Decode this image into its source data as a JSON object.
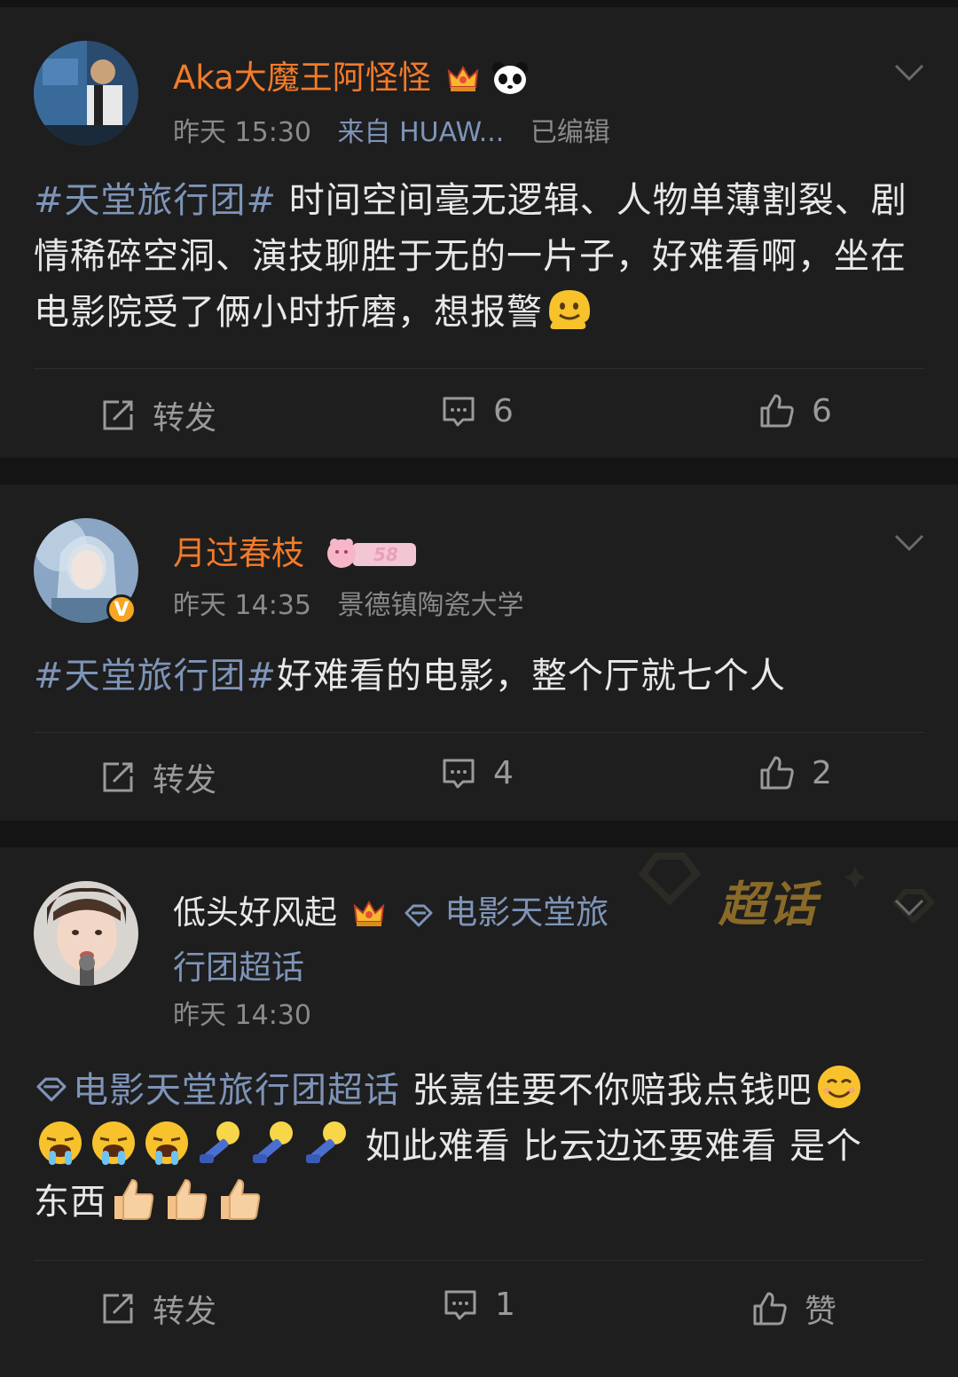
{
  "posts": [
    {
      "username": "Aka大魔王阿怪怪",
      "time": "昨天 15:30",
      "source": "来自 HUAW...",
      "edited": "已编辑",
      "topic": "#天堂旅行团#",
      "text": " 时间空间毫无逻辑、人物单薄割裂、剧情稀碎空洞、演技聊胜于无的一片子，好难看啊，坐在电影院受了俩小时折磨，想报警",
      "emojis": [
        "melting-face-emoji"
      ],
      "repost_label": "转发",
      "comment_count": "6",
      "like_count": "6"
    },
    {
      "username": "月过春枝",
      "time": "昨天 14:35",
      "source": "景德镇陶瓷大学",
      "verified": "V",
      "member_badge": "58",
      "topic": "#天堂旅行团#",
      "text": "好难看的电影，整个厅就七个人",
      "repost_label": "转发",
      "comment_count": "4",
      "like_count": "2"
    },
    {
      "username": "低头好风起",
      "topic_line1": "电影天堂旅",
      "topic_line2": "行团超话",
      "super_label": "超话",
      "time": "昨天 14:30",
      "topic": "电影天堂旅行团超话",
      "text_a": " 张嘉佳要不你赔我点钱吧",
      "text_b": " 如此难看 比云边还要难看 是个",
      "text_c": "东西",
      "emojis": [
        "smiling-face",
        "drooling-face",
        "drooling-face",
        "drooling-face",
        "gavel",
        "gavel",
        "gavel",
        "thumbs-up",
        "thumbs-up",
        "thumbs-up"
      ],
      "repost_label": "转发",
      "comment_count": "1",
      "like_label": "赞"
    }
  ],
  "colors": {
    "background": "#141414",
    "card": "#1e1e1e",
    "username_orange": "#f27b2a",
    "topic_blue": "#7e94b8",
    "meta_gray": "#8a8a8a"
  }
}
